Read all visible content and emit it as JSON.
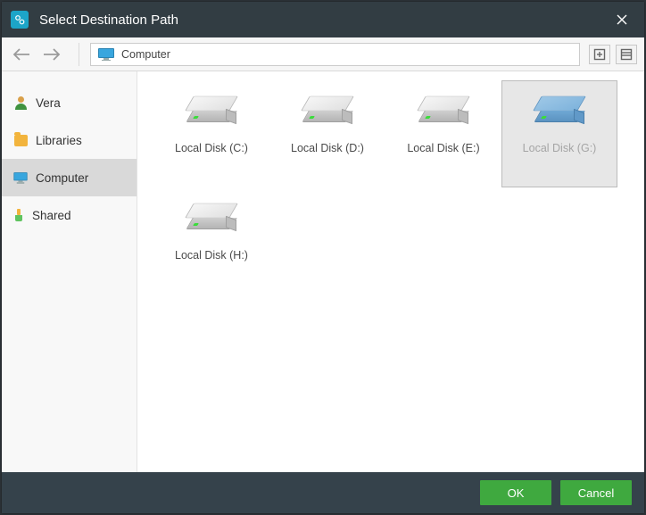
{
  "window": {
    "title": "Select Destination Path"
  },
  "toolbar": {
    "path": "Computer"
  },
  "sidebar": {
    "items": [
      {
        "label": "Vera"
      },
      {
        "label": "Libraries"
      },
      {
        "label": "Computer"
      },
      {
        "label": "Shared"
      }
    ],
    "selected": "Computer"
  },
  "drives": [
    {
      "label": "Local Disk (C:)",
      "selected": false
    },
    {
      "label": "Local Disk (D:)",
      "selected": false
    },
    {
      "label": "Local Disk (E:)",
      "selected": false
    },
    {
      "label": "Local Disk (G:)",
      "selected": true
    },
    {
      "label": "Local Disk (H:)",
      "selected": false
    }
  ],
  "footer": {
    "ok": "OK",
    "cancel": "Cancel"
  }
}
